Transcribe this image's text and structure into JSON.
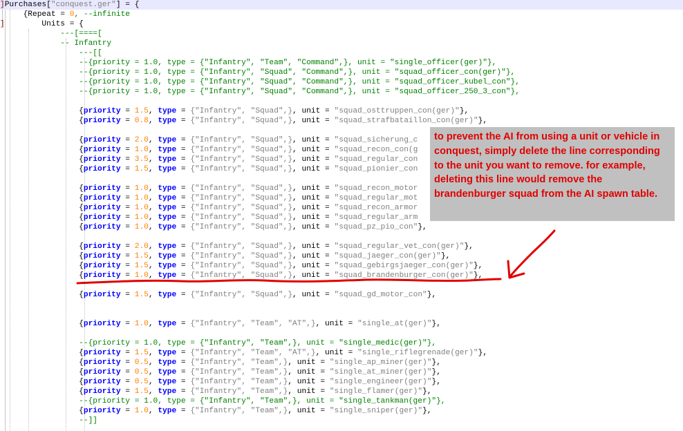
{
  "editor": {
    "lines": [
      {
        "kind": "head",
        "marker": "]",
        "pre": "Purchases[",
        "str": "\"conquest.ger\"",
        "post": "] = {",
        "current": true
      },
      {
        "kind": "head",
        "marker": "",
        "pre": "    {Repeat = ",
        "num": "0",
        "comment": ", --infinite"
      },
      {
        "kind": "plain",
        "marker": "]",
        "text": "        Units = {"
      },
      {
        "kind": "comment",
        "text": "            ---[====["
      },
      {
        "kind": "comment",
        "text": "            -- Infantry"
      },
      {
        "kind": "comment",
        "text": "                ---[["
      },
      {
        "kind": "comment",
        "text": "                --{priority = 1.0, type = {\"Infantry\", \"Team\", \"Command\",}, unit = \"single_officer(ger)\"},"
      },
      {
        "kind": "comment",
        "text": "                --{priority = 1.0, type = {\"Infantry\", \"Squad\", \"Command\",}, unit = \"squad_officer_con(ger)\"},"
      },
      {
        "kind": "comment",
        "text": "                --{priority = 1.0, type = {\"Infantry\", \"Squad\", \"Command\",}, unit = \"squad_officer_kubel_con\"},"
      },
      {
        "kind": "comment",
        "text": "                --{priority = 1.0, type = {\"Infantry\", \"Squad\", \"Command\",}, unit = \"squad_officer_250_3_con\"},"
      },
      {
        "kind": "blank"
      },
      {
        "kind": "code",
        "prio": "1.5",
        "types": "{\"Infantry\", \"Squad\",}",
        "unit": "\"squad_osttruppen_con(ger)\"",
        "tail": "},"
      },
      {
        "kind": "code",
        "prio": "0.8",
        "types": "{\"Infantry\", \"Squad\",}",
        "unit": "\"squad_strafbataillon_con(ger)\"",
        "tail": "},"
      },
      {
        "kind": "blank"
      },
      {
        "kind": "code",
        "prio": "2.0",
        "types": "{\"Infantry\", \"Squad\",}",
        "unit": "\"squad_sicherung_c",
        "tail": ""
      },
      {
        "kind": "code",
        "prio": "1.0",
        "types": "{\"Infantry\", \"Squad\",}",
        "unit": "\"squad_recon_con(g",
        "tail": ""
      },
      {
        "kind": "code",
        "prio": "3.5",
        "types": "{\"Infantry\", \"Squad\",}",
        "unit": "\"squad_regular_con",
        "tail": ""
      },
      {
        "kind": "code",
        "prio": "1.5",
        "types": "{\"Infantry\", \"Squad\",}",
        "unit": "\"squad_pionier_con",
        "tail": ""
      },
      {
        "kind": "blank"
      },
      {
        "kind": "code",
        "prio": "1.0",
        "types": "{\"Infantry\", \"Squad\",}",
        "unit": "\"squad_recon_motor",
        "tail": ""
      },
      {
        "kind": "code",
        "prio": "1.0",
        "types": "{\"Infantry\", \"Squad\",}",
        "unit": "\"squad_regular_mot",
        "tail": ""
      },
      {
        "kind": "code",
        "prio": "1.0",
        "types": "{\"Infantry\", \"Squad\",}",
        "unit": "\"squad_recon_armor",
        "tail": ""
      },
      {
        "kind": "code",
        "prio": "1.0",
        "types": "{\"Infantry\", \"Squad\",}",
        "unit": "\"squad_regular_arm",
        "tail": ""
      },
      {
        "kind": "code",
        "prio": "1.0",
        "types": "{\"Infantry\", \"Squad\",}",
        "unit": "\"squad_pz_pio_con\"",
        "tail": "},"
      },
      {
        "kind": "blank"
      },
      {
        "kind": "code",
        "prio": "2.0",
        "types": "{\"Infantry\", \"Squad\",}",
        "unit": "\"squad_regular_vet_con(ger)\"",
        "tail": "},"
      },
      {
        "kind": "code",
        "prio": "1.5",
        "types": "{\"Infantry\", \"Squad\",}",
        "unit": "\"squad_jaeger_con(ger)\"",
        "tail": "},"
      },
      {
        "kind": "code",
        "prio": "1.5",
        "types": "{\"Infantry\", \"Squad\",}",
        "unit": "\"squad_gebirgsjaeger_con(ger)\"",
        "tail": "},"
      },
      {
        "kind": "code",
        "prio": "1.0",
        "types": "{\"Infantry\", \"Squad\",}",
        "unit": "\"squad_brandenburger_con(ger)\"",
        "tail": "},"
      },
      {
        "kind": "blank"
      },
      {
        "kind": "code",
        "prio": "1.5",
        "types": "{\"Infantry\", \"Squad\",}",
        "unit": "\"squad_gd_motor_con\"",
        "tail": "},"
      },
      {
        "kind": "blank"
      },
      {
        "kind": "blank"
      },
      {
        "kind": "code",
        "prio": "1.0",
        "types": "{\"Infantry\", \"Team\", \"AT\",}",
        "unit": "\"single_at(ger)\"",
        "tail": "},"
      },
      {
        "kind": "blank"
      },
      {
        "kind": "comment",
        "text": "                --{priority = 1.0, type = {\"Infantry\", \"Team\",}, unit = \"single_medic(ger)\"},"
      },
      {
        "kind": "code",
        "prio": "1.5",
        "types": "{\"Infantry\", \"Team\", \"AT\",}",
        "unit": "\"single_riflegrenade(ger)\"",
        "tail": "},"
      },
      {
        "kind": "code",
        "prio": "0.5",
        "types": "{\"Infantry\", \"Team\",}",
        "unit": "\"single_ap_miner(ger)\"",
        "tail": "},"
      },
      {
        "kind": "code",
        "prio": "0.5",
        "types": "{\"Infantry\", \"Team\",}",
        "unit": "\"single_at_miner(ger)\"",
        "tail": "},"
      },
      {
        "kind": "code",
        "prio": "0.5",
        "types": "{\"Infantry\", \"Team\",}",
        "unit": "\"single_engineer(ger)\"",
        "tail": "},"
      },
      {
        "kind": "code",
        "prio": "1.5",
        "types": "{\"Infantry\", \"Team\",}",
        "unit": "\"single_flamer(ger)\"",
        "tail": "},"
      },
      {
        "kind": "comment",
        "text": "                --{priority = 1.0, type = {\"Infantry\", \"Team\",}, unit = \"single_tankman(ger)\"},"
      },
      {
        "kind": "code",
        "prio": "1.0",
        "types": "{\"Infantry\", \"Team\",}",
        "unit": "\"single_sniper(ger)\"",
        "tail": "},"
      },
      {
        "kind": "comment",
        "text": "                --]]"
      }
    ]
  },
  "callout": {
    "text": "to prevent the AI from using a unit or vehicle in conquest, simply delete the line corresponding to the unit you want to remove. for example, deleting this line would remove the brandenburger squad from the AI spawn table."
  },
  "colors": {
    "keyword": "#0000ff",
    "number": "#ff8000",
    "string": "#808080",
    "comment": "#008000",
    "annotation": "#e00000",
    "callout_bg": "#c0c0c0"
  }
}
